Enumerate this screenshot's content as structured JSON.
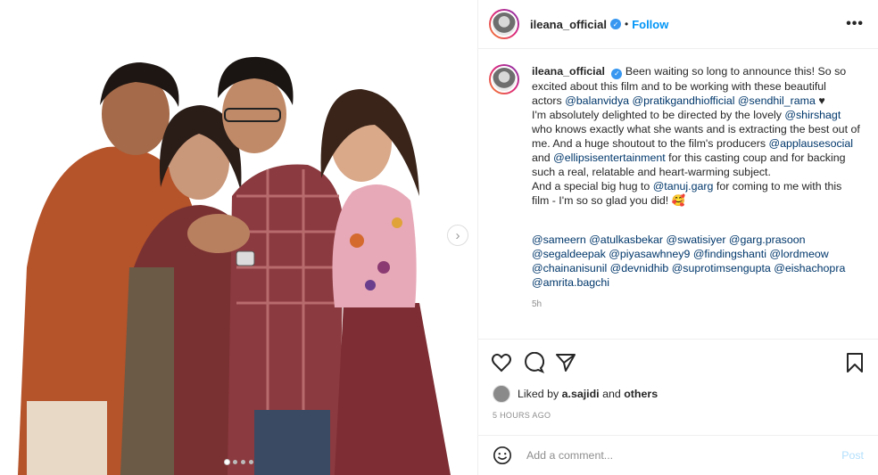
{
  "header": {
    "username": "ileana_official",
    "separator": "•",
    "follow_label": "Follow",
    "more_label": "•••",
    "verified_icon": "verified-icon"
  },
  "caption": {
    "username": "ileana_official",
    "lines": [
      "Been waiting so long to announce this! So so",
      "excited about this film and to be working with these beautiful",
      "actors",
      "I'm absolutely delighted to be directed by the lovely",
      "who knows exactly what she wants and is extracting the best out of",
      "me. And a huge shoutout to the film's producers",
      "and",
      "for this casting coup and for backing",
      "such a real, relatable and heart-warming subject.",
      "And a special big hug to",
      "for coming to me with this",
      "film - I'm so so glad you did! 🥰"
    ],
    "tags": {
      "balanvidya": "@balanvidya",
      "pratikgandhi": "@pratikgandhiofficial",
      "sendhil": "@sendhil_rama",
      "heart": "♥",
      "shirshagt": "@shirshagt",
      "applause": "@applausesocial",
      "ellipsis": "@ellipsisentertainment",
      "tanuj": "@tanuj.garg"
    },
    "credits": [
      "@sameern @atulkasbekar @swatisiyer @garg.prasoon",
      "@segaldeepak @piyasawhney9 @findingshanti @lordmeow",
      "@chainanisunil @devnidhib @suprotimsengupta @eishachopra",
      "@amrita.bagchi"
    ],
    "time": "5h"
  },
  "likes": {
    "prefix": "Liked by",
    "user": "a.sajidi",
    "and": "and",
    "others": "others"
  },
  "posted_ago": "5 HOURS AGO",
  "comment": {
    "placeholder": "Add a comment...",
    "post_label": "Post"
  },
  "carousel": {
    "next_label": "›",
    "slide_count": 4,
    "active_index": 0
  },
  "colors": {
    "accent": "#0095f6",
    "link": "#00376b",
    "muted": "#8e8e8e",
    "border": "#efefef"
  }
}
